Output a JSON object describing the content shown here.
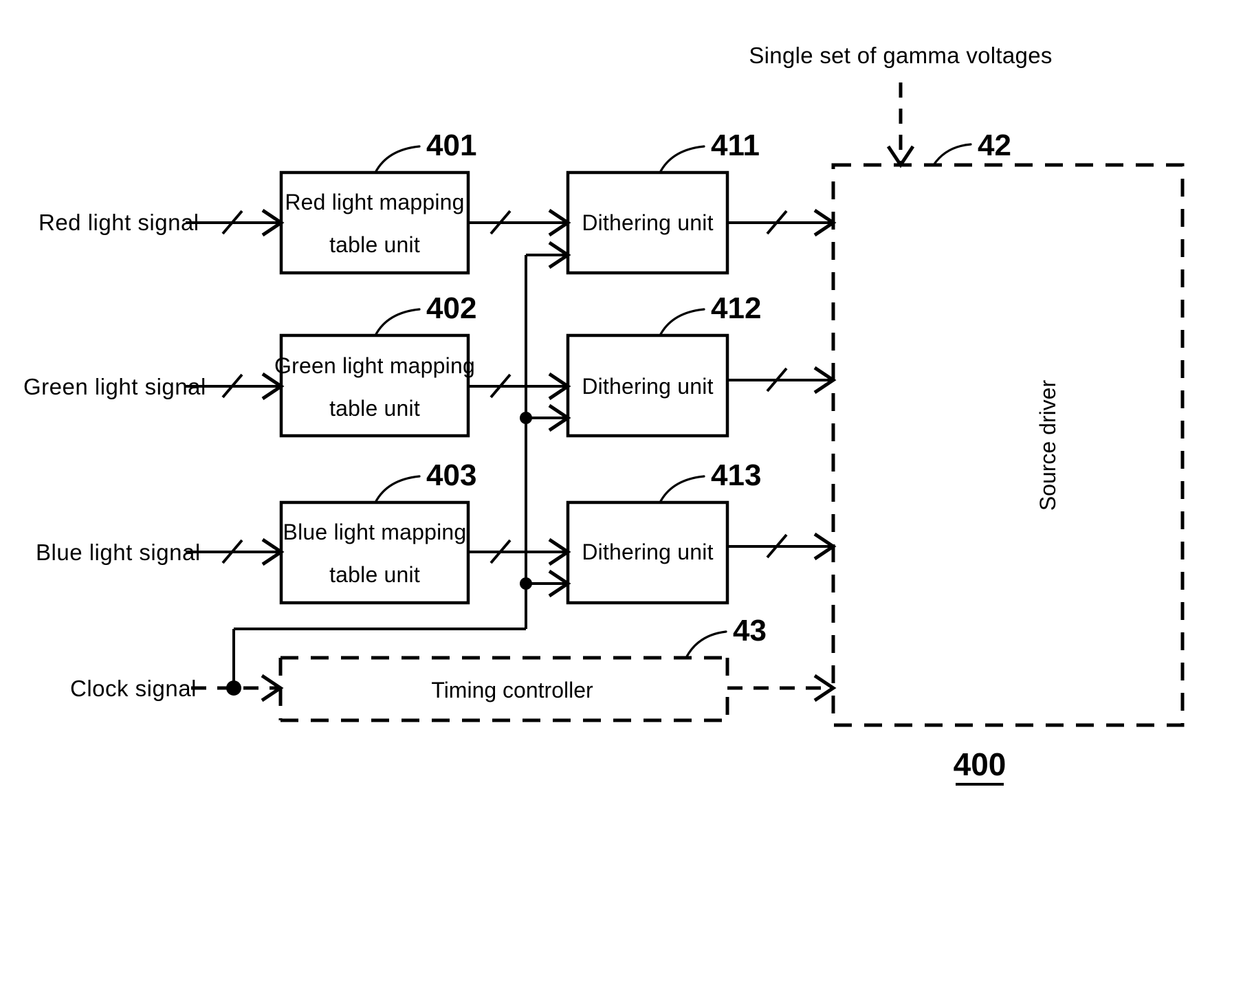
{
  "figure": {
    "number": "400",
    "title_gamma": "Single set of gamma voltages"
  },
  "inputs": [
    {
      "label": "Red light signal"
    },
    {
      "label": "Green light signal"
    },
    {
      "label": "Blue light signal"
    },
    {
      "label": "Clock signal"
    }
  ],
  "mapping_units": [
    {
      "ref": "401",
      "line1": "Red light mapping",
      "line2": "table unit"
    },
    {
      "ref": "402",
      "line1": "Green light mapping",
      "line2": "table unit"
    },
    {
      "ref": "403",
      "line1": "Blue light mapping",
      "line2": "table unit"
    }
  ],
  "dithering_units": [
    {
      "ref": "411",
      "label": "Dithering unit"
    },
    {
      "ref": "412",
      "label": "Dithering unit"
    },
    {
      "ref": "413",
      "label": "Dithering unit"
    }
  ],
  "source_driver": {
    "ref": "42",
    "label": "Source driver"
  },
  "timing_controller": {
    "ref": "43",
    "label": "Timing controller"
  },
  "colors": {
    "ink": "#000000",
    "paper": "#ffffff"
  }
}
